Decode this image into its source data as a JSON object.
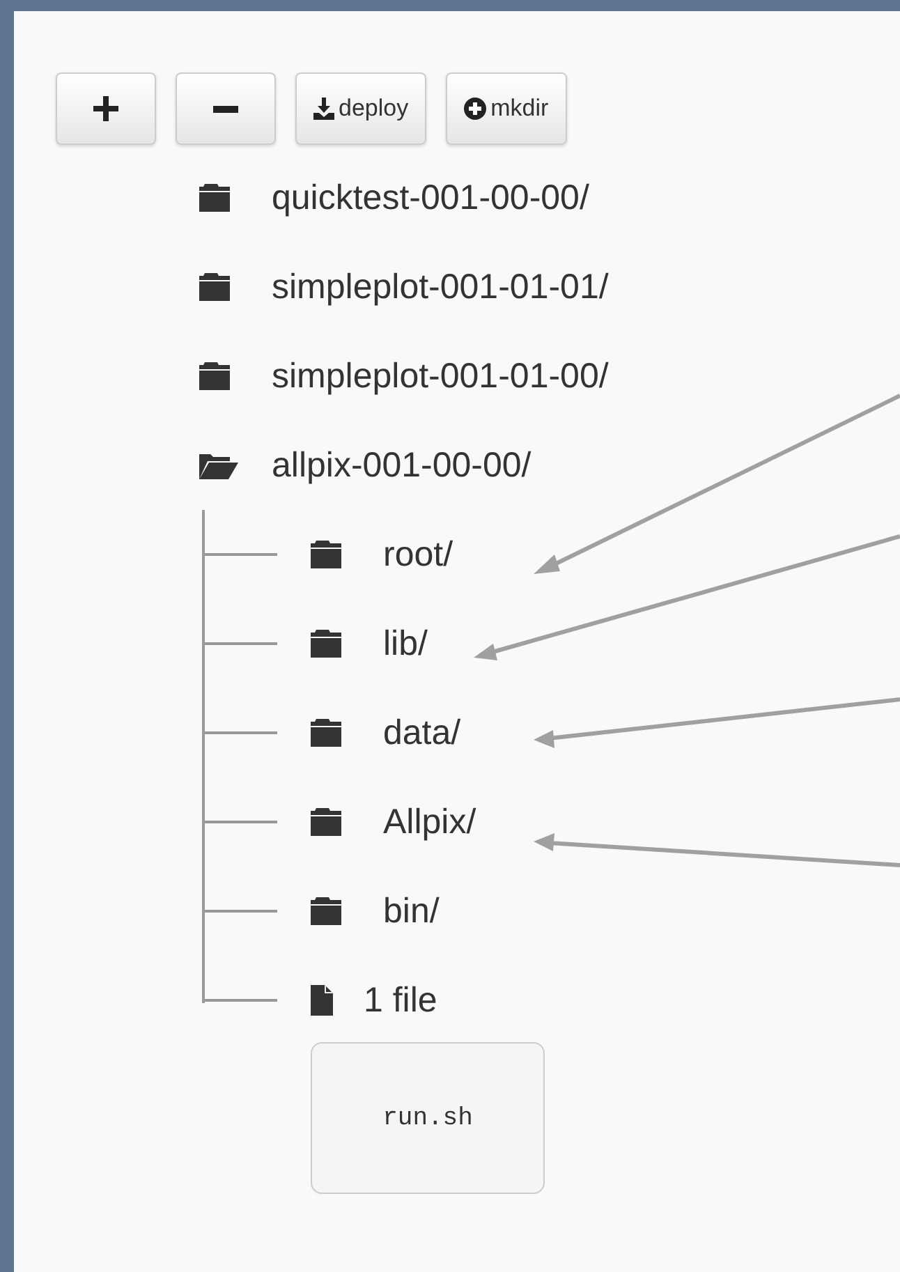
{
  "toolbar": [
    {
      "kind": "plus"
    },
    {
      "kind": "minus"
    },
    {
      "kind": "download",
      "label": "deploy"
    },
    {
      "kind": "plus-circle",
      "label": "mkdir"
    }
  ],
  "tree": [
    {
      "kind": "folder",
      "name": "quicktest-001-00-00/",
      "expanded": false
    },
    {
      "kind": "folder",
      "name": "simpleplot-001-01-01/",
      "expanded": false
    },
    {
      "kind": "folder",
      "name": "simpleplot-001-01-00/",
      "expanded": false
    },
    {
      "kind": "folder",
      "name": "allpix-001-00-00/",
      "expanded": true,
      "children": [
        {
          "kind": "folder",
          "name": "root/",
          "expanded": false
        },
        {
          "kind": "folder",
          "name": "lib/",
          "expanded": false
        },
        {
          "kind": "folder",
          "name": "data/",
          "expanded": false
        },
        {
          "kind": "folder",
          "name": "Allpix/",
          "expanded": false
        },
        {
          "kind": "folder",
          "name": "bin/",
          "expanded": false
        },
        {
          "kind": "files",
          "name": "1 file",
          "files": [
            "run.sh"
          ]
        }
      ]
    }
  ]
}
